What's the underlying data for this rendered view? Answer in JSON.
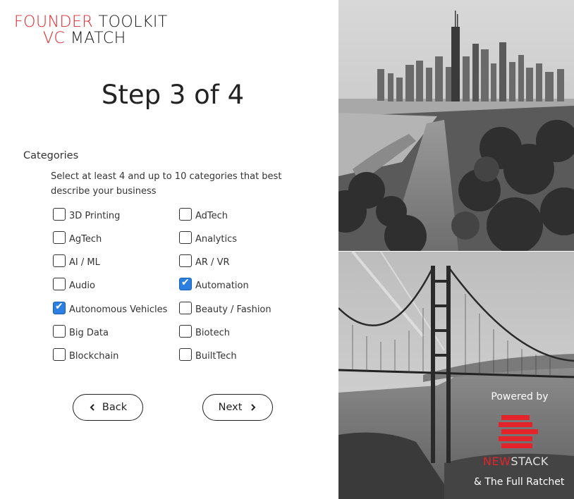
{
  "brand": {
    "word1": "FOUNDER",
    "word2": "TOOLKIT",
    "word3": "VC",
    "word4": "MATCH"
  },
  "step": {
    "title": "Step 3 of 4"
  },
  "form": {
    "section_label": "Categories",
    "helper_text": "Select at least 4 and up to 10 categories that best describe your business",
    "categories": [
      {
        "label": "3D Printing",
        "checked": false
      },
      {
        "label": "AdTech",
        "checked": false
      },
      {
        "label": "AgTech",
        "checked": false
      },
      {
        "label": "Analytics",
        "checked": false
      },
      {
        "label": "AI / ML",
        "checked": false
      },
      {
        "label": "AR / VR",
        "checked": false
      },
      {
        "label": "Audio",
        "checked": false
      },
      {
        "label": "Automation",
        "checked": true
      },
      {
        "label": "Autonomous Vehicles",
        "checked": true
      },
      {
        "label": "Beauty / Fashion",
        "checked": false
      },
      {
        "label": "Big Data",
        "checked": false
      },
      {
        "label": "Biotech",
        "checked": false
      },
      {
        "label": "Blockchain",
        "checked": false
      },
      {
        "label": "BuiltTech",
        "checked": false
      }
    ]
  },
  "nav": {
    "back_label": "Back",
    "next_label": "Next",
    "back_icon": "chevron-left-icon",
    "next_icon": "chevron-right-icon"
  },
  "sidebar": {
    "powered_by": "Powered by",
    "partner_logo_new": "NEW",
    "partner_logo_stack": "STACK",
    "partner_secondary": "& The Full Ratchet"
  },
  "colors": {
    "brand_red": "#e3242b",
    "checkbox_blue": "#2b7fe0",
    "text_dark": "#222222"
  }
}
